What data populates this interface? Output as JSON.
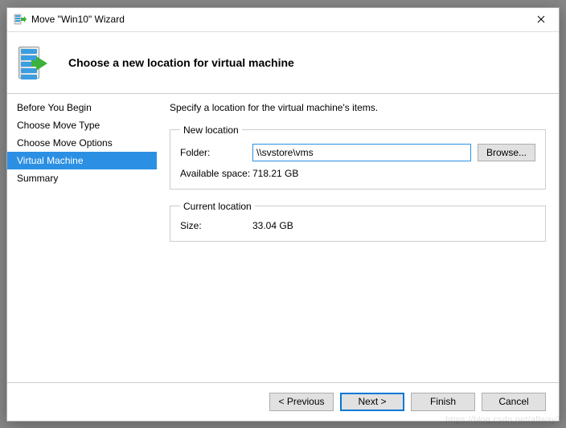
{
  "window": {
    "title": "Move \"Win10\" Wizard"
  },
  "header": {
    "title": "Choose a new location for virtual machine"
  },
  "sidebar": {
    "items": [
      {
        "label": "Before You Begin",
        "selected": false
      },
      {
        "label": "Choose Move Type",
        "selected": false
      },
      {
        "label": "Choose Move Options",
        "selected": false
      },
      {
        "label": "Virtual Machine",
        "selected": true
      },
      {
        "label": "Summary",
        "selected": false
      }
    ]
  },
  "content": {
    "description": "Specify a location for the virtual machine's items.",
    "new_location": {
      "legend": "New location",
      "folder_label": "Folder:",
      "folder_value": "\\\\svstore\\vms",
      "browse_label": "Browse...",
      "available_space_label": "Available space:",
      "available_space_value": "718.21 GB"
    },
    "current_location": {
      "legend": "Current location",
      "size_label": "Size:",
      "size_value": "33.04 GB"
    }
  },
  "footer": {
    "previous": "< Previous",
    "next": "Next >",
    "finish": "Finish",
    "cancel": "Cancel"
  },
  "watermark": "https://blog.csdn.net/allway2"
}
